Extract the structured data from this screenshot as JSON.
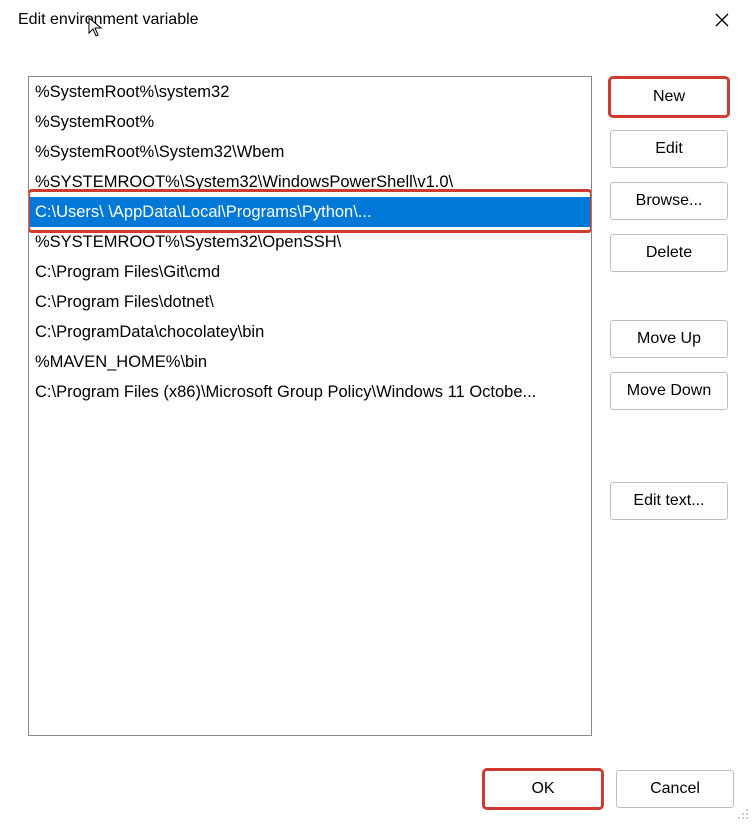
{
  "window": {
    "title": "Edit environment variable"
  },
  "list": {
    "items": [
      {
        "text": "%SystemRoot%\\system32",
        "selected": false
      },
      {
        "text": "%SystemRoot%",
        "selected": false
      },
      {
        "text": "%SystemRoot%\\System32\\Wbem",
        "selected": false
      },
      {
        "text": "%SYSTEMROOT%\\System32\\WindowsPowerShell\\v1.0\\",
        "selected": false
      },
      {
        "text": "C:\\Users\\                                     \\AppData\\Local\\Programs\\Python\\...",
        "selected": true
      },
      {
        "text": "%SYSTEMROOT%\\System32\\OpenSSH\\",
        "selected": false
      },
      {
        "text": "C:\\Program Files\\Git\\cmd",
        "selected": false
      },
      {
        "text": "C:\\Program Files\\dotnet\\",
        "selected": false
      },
      {
        "text": "C:\\ProgramData\\chocolatey\\bin",
        "selected": false
      },
      {
        "text": "%MAVEN_HOME%\\bin",
        "selected": false
      },
      {
        "text": "C:\\Program Files (x86)\\Microsoft Group Policy\\Windows 11 Octobe...",
        "selected": false
      }
    ]
  },
  "buttons": {
    "new": "New",
    "edit": "Edit",
    "browse": "Browse...",
    "delete": "Delete",
    "move_up": "Move Up",
    "move_down": "Move Down",
    "edit_text": "Edit text...",
    "ok": "OK",
    "cancel": "Cancel"
  },
  "highlights": {
    "new_button": true,
    "selected_row": true,
    "ok_button": true
  }
}
